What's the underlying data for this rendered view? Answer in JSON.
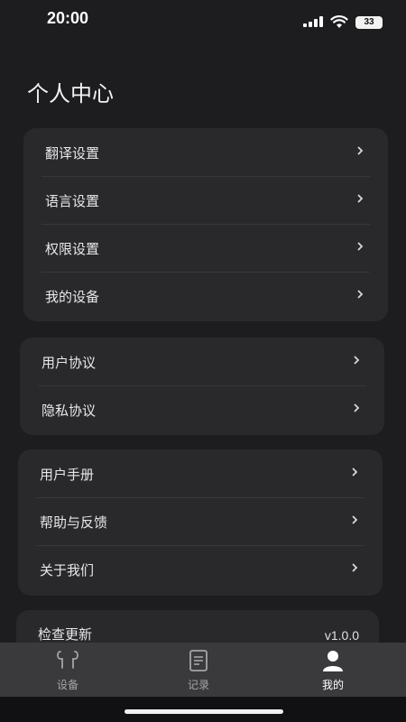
{
  "status_bar": {
    "time": "20:00",
    "battery": "33"
  },
  "page_title": "个人中心",
  "groups": [
    {
      "items": [
        {
          "label": "翻译设置"
        },
        {
          "label": "语言设置"
        },
        {
          "label": "权限设置"
        },
        {
          "label": "我的设备"
        }
      ]
    },
    {
      "items": [
        {
          "label": "用户协议"
        },
        {
          "label": "隐私协议"
        }
      ]
    },
    {
      "items": [
        {
          "label": "用户手册"
        },
        {
          "label": "帮助与反馈"
        },
        {
          "label": "关于我们"
        }
      ]
    }
  ],
  "update": {
    "label": "检查更新",
    "version": "v1.0.0"
  },
  "tab_bar": {
    "tabs": [
      {
        "label": "设备",
        "icon": "earbuds-icon"
      },
      {
        "label": "记录",
        "icon": "document-icon"
      },
      {
        "label": "我的",
        "icon": "user-icon",
        "active": true
      }
    ]
  },
  "colors": {
    "background": "#1d1d20",
    "card": "#29292c",
    "tab_bar": "#3a3a3c",
    "text": "#e8e8e8",
    "tab_inactive": "#a5a5a8",
    "tab_active": "#ffffff"
  }
}
